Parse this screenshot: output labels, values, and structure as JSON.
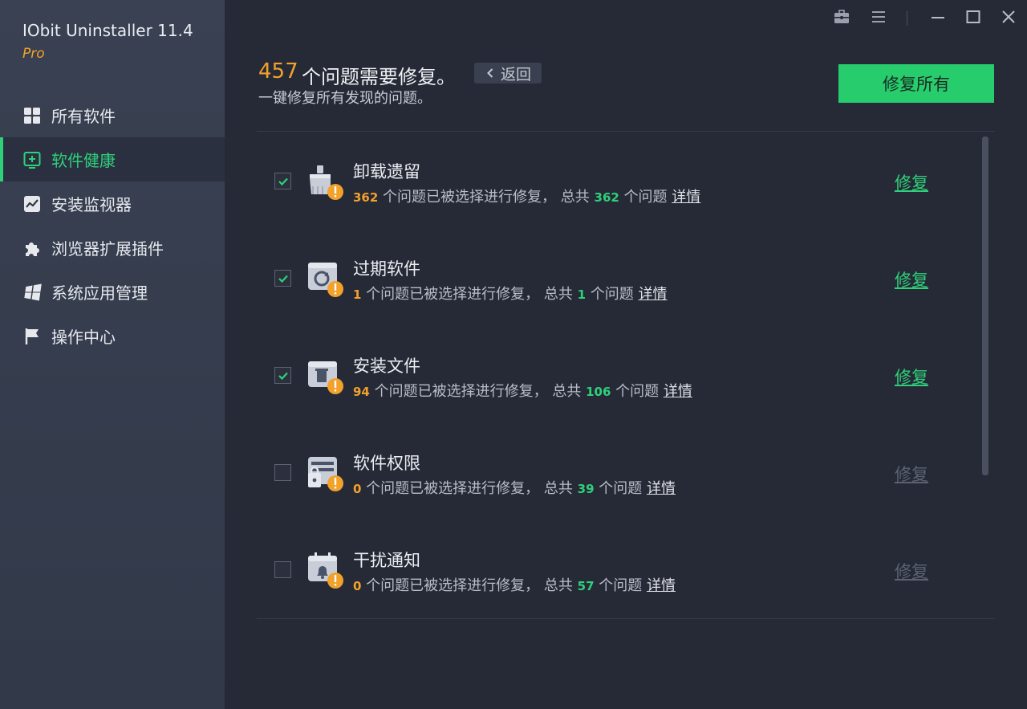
{
  "app": {
    "title": "IObit Uninstaller 11.4",
    "edition": "Pro"
  },
  "sidebar": {
    "items": [
      {
        "label": "所有软件",
        "icon": "grid-icon",
        "active": false
      },
      {
        "label": "软件健康",
        "icon": "health-plus-icon",
        "active": true
      },
      {
        "label": "安装监视器",
        "icon": "monitor-chart-icon",
        "active": false
      },
      {
        "label": "浏览器扩展插件",
        "icon": "puzzle-icon",
        "active": false
      },
      {
        "label": "系统应用管理",
        "icon": "windows-logo-icon",
        "active": false
      },
      {
        "label": "操作中心",
        "icon": "flag-icon",
        "active": false
      }
    ]
  },
  "window_controls": [
    "toolbox-icon",
    "menu-icon",
    "minimize-icon",
    "maximize-icon",
    "close-icon"
  ],
  "header": {
    "count": "457",
    "title": "个问题需要修复。",
    "back_label": "返回",
    "subtitle": "一键修复所有发现的问题。",
    "fix_all_label": "修复所有"
  },
  "issues": [
    {
      "title": "卸载遗留",
      "icon": "broom-icon",
      "checked": true,
      "selected": "362",
      "total": "362",
      "enabled": true
    },
    {
      "title": "过期软件",
      "icon": "outdated-app-icon",
      "checked": true,
      "selected": "1",
      "total": "1",
      "enabled": true
    },
    {
      "title": "安装文件",
      "icon": "install-file-icon",
      "checked": true,
      "selected": "94",
      "total": "106",
      "enabled": true
    },
    {
      "title": "软件权限",
      "icon": "permission-lock-icon",
      "checked": false,
      "selected": "0",
      "total": "39",
      "enabled": false
    },
    {
      "title": "干扰通知",
      "icon": "notification-bell-icon",
      "checked": false,
      "selected": "0",
      "total": "57",
      "enabled": false
    }
  ],
  "strings": {
    "selected_suffix": "个问题已被选择进行修复，",
    "total_prefix": "总共",
    "total_suffix": "个问题",
    "details_label": "详情",
    "fix_label": "修复"
  },
  "colors": {
    "accent_green": "#27cc6c",
    "accent_orange": "#f2a12b",
    "sidebar_bg": "#394152",
    "main_bg": "#262a36"
  }
}
